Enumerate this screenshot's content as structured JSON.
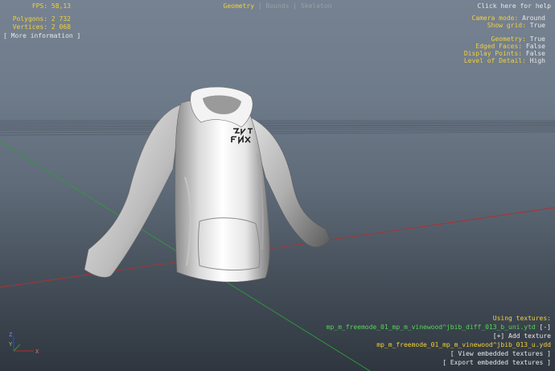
{
  "tabs": {
    "geometry": "Geometry",
    "bounds": "Bounds",
    "skeleton": "Skeleton",
    "separator": "|"
  },
  "stats": {
    "fps_label": "FPS:",
    "fps_value": "58,13",
    "polygons_label": "Polygons:",
    "polygons_value": "2 732",
    "vertices_label": "Vertices:",
    "vertices_value": "2 068",
    "more_info": "[ More information ]"
  },
  "help": "Click here for help",
  "camera": {
    "camera_mode_label": "Camera mode:",
    "camera_mode_value": "Around",
    "show_grid_label": "Show grid:",
    "show_grid_value": "True"
  },
  "geometry_settings": {
    "geometry_label": "Geometry:",
    "geometry_value": "True",
    "edged_faces_label": "Edged Faces:",
    "edged_faces_value": "False",
    "display_points_label": "Display Points:",
    "display_points_value": "False",
    "lod_label": "Level of Detail:",
    "lod_value": "High"
  },
  "textures": {
    "heading": "Using textures:",
    "texture_file": "mp_m_freemode_01_mp_m_vinewood^jbib_diff_013_b_uni.ytd",
    "remove": "[-]",
    "add": "[+] Add texture",
    "model_file": "mp_m_freemode_01_mp_m_vinewood^jbib_013_u.ydd",
    "view_embedded": "[ View embedded textures ]",
    "export_embedded": "[ Export embedded textures ]"
  },
  "colors": {
    "label_yellow": "#f2d03b",
    "value_white": "#e8e8e8",
    "texture_green": "#55d655",
    "axis_red": "#b03030",
    "axis_green": "#2f9a3a",
    "axis_blue": "#2f4fc0"
  }
}
